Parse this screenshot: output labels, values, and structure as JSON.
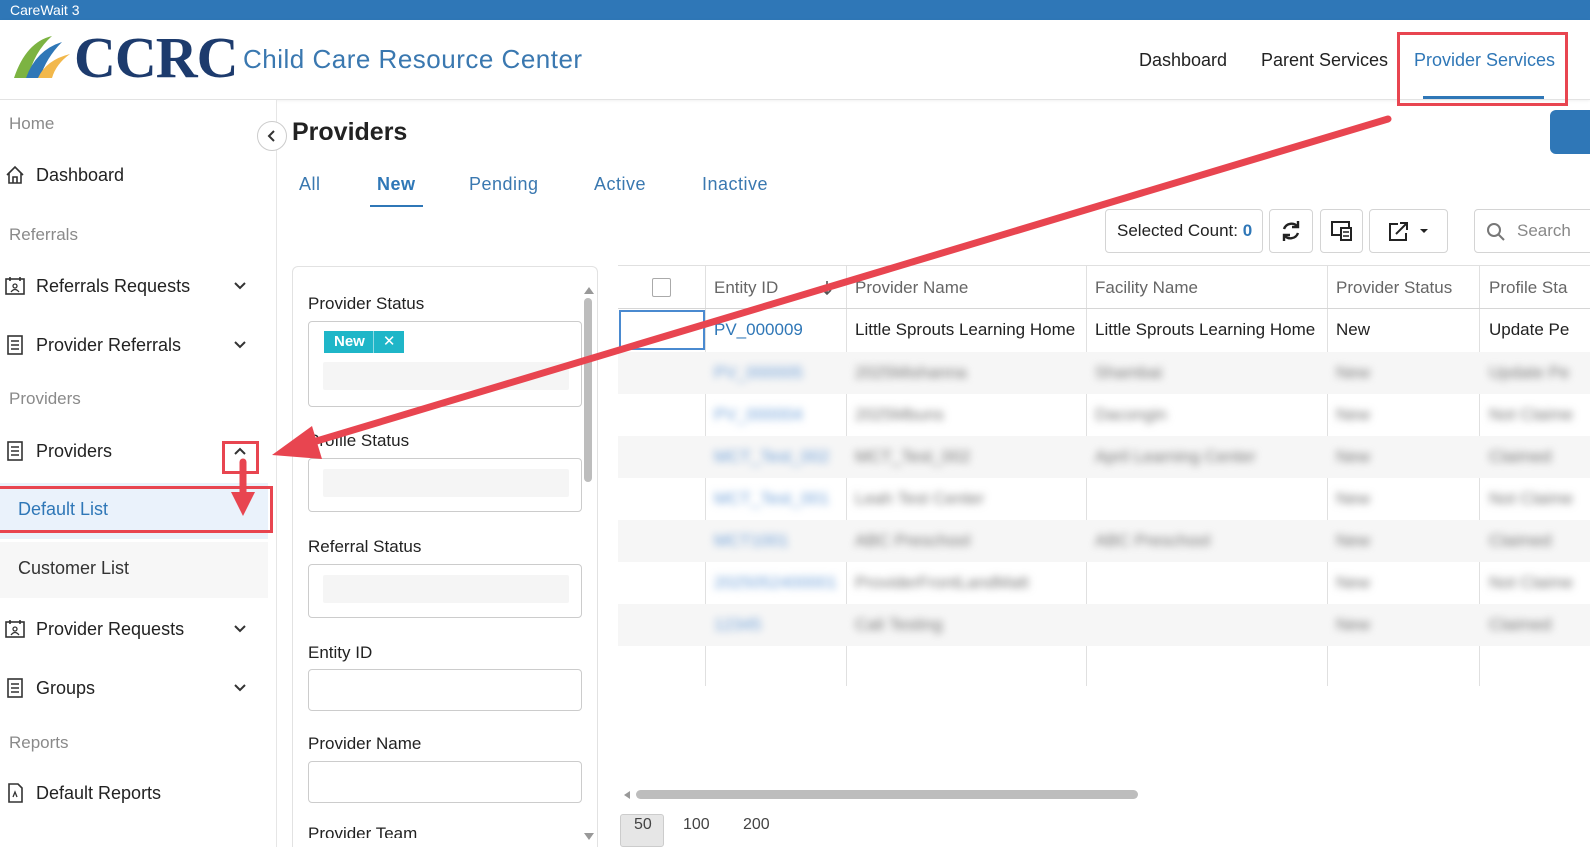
{
  "window": {
    "title": "CareWait 3"
  },
  "brand": {
    "logo_text": "CCRC",
    "subtitle": "Child Care Resource Center"
  },
  "topnav": [
    {
      "label": "Dashboard"
    },
    {
      "label": "Parent Services"
    },
    {
      "label": "Provider Services",
      "active": true
    }
  ],
  "sidebar": {
    "home": "Home",
    "dashboard": "Dashboard",
    "sections": {
      "referrals": "Referrals",
      "providers": "Providers",
      "reports": "Reports"
    },
    "items": {
      "referrals_requests": "Referrals Requests",
      "provider_referrals": "Provider Referrals",
      "providers": "Providers",
      "default_list": "Default List",
      "customer_list": "Customer List",
      "provider_requests": "Provider Requests",
      "groups": "Groups",
      "default_reports": "Default Reports"
    }
  },
  "page": {
    "title": "Providers"
  },
  "tabs": [
    "All",
    "New",
    "Pending",
    "Active",
    "Inactive"
  ],
  "toolbar": {
    "selected_count_label": "Selected Count:",
    "selected_count": "0",
    "search_placeholder": "Search"
  },
  "filters": {
    "provider_status": "Provider Status",
    "provider_status_chip": "New",
    "chip_remove": "✕",
    "profile_status": "Profile Status",
    "referral_status": "Referral Status",
    "entity_id": "Entity ID",
    "provider_name": "Provider Name",
    "provider_team": "Provider Team"
  },
  "table": {
    "columns": [
      "Entity ID",
      "Provider Name",
      "Facility Name",
      "Provider Status",
      "Profile Sta"
    ],
    "rows": [
      [
        "PV_000009",
        "Little Sprouts Learning Home",
        "Little Sprouts Learning Home",
        "New",
        "Update Pe"
      ],
      [
        "PV_000005",
        "2025Mishanna",
        "Shambai",
        "New",
        "Update Pe"
      ],
      [
        "PV_000004",
        "2025Mbuns",
        "Dacongin",
        "New",
        "Not Claime"
      ],
      [
        "MCT_Test_002",
        "MCT_Test_002",
        "April Learning Center",
        "New",
        "Claimed"
      ],
      [
        "MCT_Test_001",
        "Leah Test Center",
        "",
        "New",
        "Not Claime"
      ],
      [
        "MCT1001",
        "ABC Preschool",
        "ABC Preschool",
        "New",
        "Claimed"
      ],
      [
        "2025052400001",
        "ProviderFrontLandMatt",
        "",
        "New",
        "Not Claime"
      ],
      [
        "12345",
        "Cali Testing",
        "",
        "New",
        "Claimed"
      ]
    ]
  },
  "pager": [
    "50",
    "100",
    "200"
  ],
  "colors": {
    "brand": "#2f77b7",
    "annotation": "#e84550",
    "chip": "#1fb6c8"
  }
}
